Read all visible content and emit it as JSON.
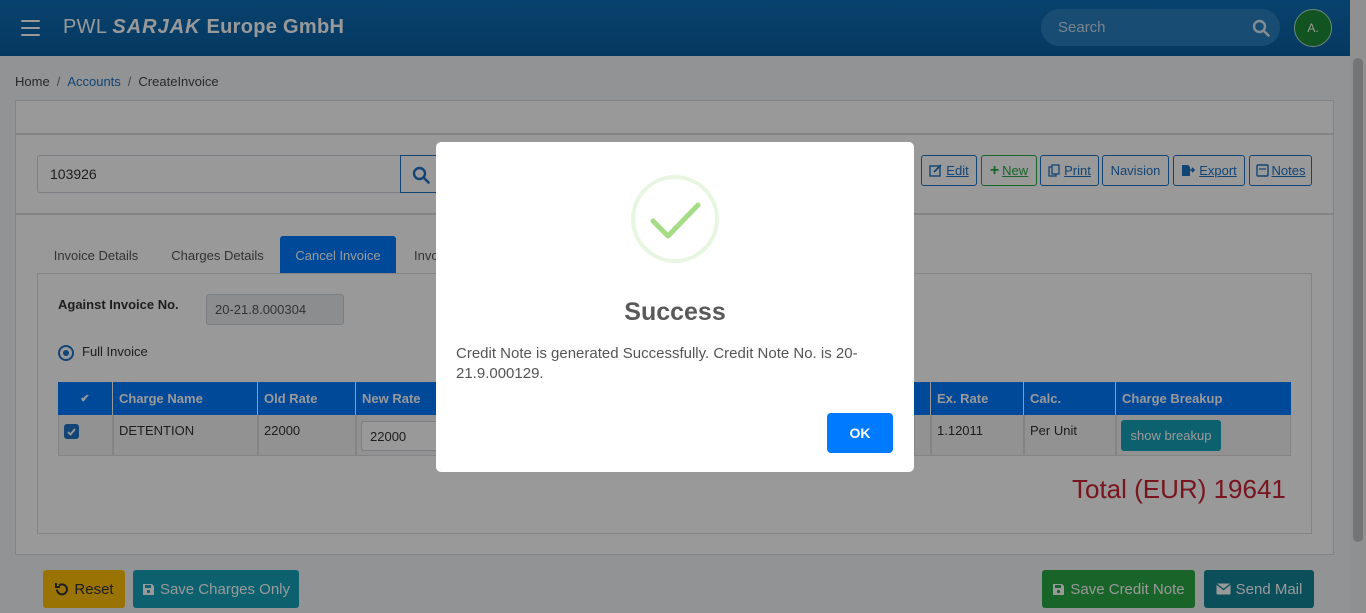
{
  "header": {
    "brand_pre": "PWL",
    "brand_mark": "SARJAK",
    "brand_post": "Europe GmbH",
    "search_placeholder": "Search",
    "avatar_initial": "A."
  },
  "breadcrumb": {
    "home": "Home",
    "accounts": "Accounts",
    "current": "CreateInvoice"
  },
  "invoice_search": {
    "value": "103926"
  },
  "toolbar": {
    "edit": "Edit",
    "new": "New",
    "print": "Print",
    "navision": "Navision",
    "export": "Export",
    "notes": "Notes"
  },
  "tabs": {
    "invoice_details": "Invoice Details",
    "charges_details": "Charges Details",
    "cancel_invoice": "Cancel Invoice",
    "partial": "Invo"
  },
  "cancel_form": {
    "against_label": "Against Invoice No.",
    "against_value": "20-21.8.000304",
    "full_invoice_label": "Full Invoice"
  },
  "table": {
    "check_header": "✔",
    "headers": {
      "charge_name": "Charge Name",
      "old_rate": "Old Rate",
      "new_rate": "New Rate",
      "ex_rate": "Ex. Rate",
      "calc": "Calc.",
      "charge_breakup": "Charge Breakup"
    },
    "row": {
      "charge_name": "DETENTION",
      "old_rate": "22000",
      "new_rate": "22000",
      "ex_rate": "1.12011",
      "calc": "Per Unit",
      "breakup_button": "show breakup"
    }
  },
  "total": "Total (EUR) 19641",
  "footer": {
    "reset": "Reset",
    "save_charges_only": "Save Charges Only",
    "save_credit_note": "Save Credit Note",
    "send_mail": "Send Mail"
  },
  "modal": {
    "title": "Success",
    "message": "Credit Note is generated Successfully. Credit Note No. is 20-21.9.000129.",
    "ok": "OK"
  },
  "colors": {
    "header_bg": "#0a5fa0",
    "primary": "#007bff",
    "success_check": "#a5dc86",
    "total_red": "#c82333",
    "reset_yellow": "#ffc107",
    "save_charges_teal": "#17a2b8",
    "save_credit_green": "#28a745",
    "send_mail_teal": "#138496"
  }
}
